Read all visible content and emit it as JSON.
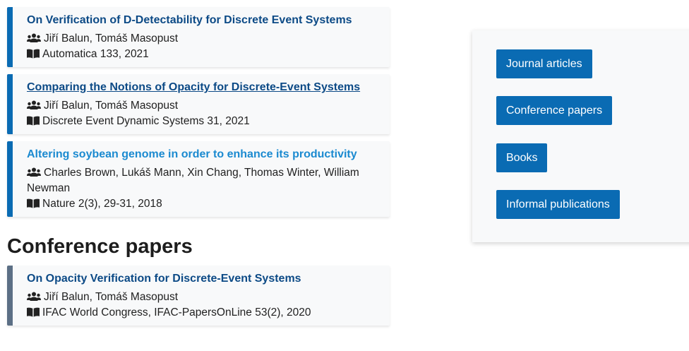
{
  "journal_articles": [
    {
      "title": "On Verification of D-Detectability for Discrete Event Systems",
      "authors": "Jiří Balun, Tomáš Masopust",
      "venue": "Automatica 133, 2021"
    },
    {
      "title": "Comparing the Notions of Opacity for Discrete-Event Systems",
      "authors": "Jiří Balun, Tomáš Masopust",
      "venue": "Discrete Event Dynamic Systems 31, 2021"
    },
    {
      "title": "Altering soybean genome in order to enhance its productivity",
      "authors": "Charles Brown, Lukáš Mann, Xin Chang, Thomas Winter, William Newman",
      "venue": "Nature 2(3), 29-31, 2018"
    }
  ],
  "conference_heading": "Conference papers",
  "conference_papers": [
    {
      "title": "On Opacity Verification for Discrete-Event Systems",
      "authors": "Jiří Balun, Tomáš Masopust",
      "venue": "IFAC World Congress, IFAC-PapersOnLine 53(2), 2020"
    }
  ],
  "nav": {
    "journal": "Journal articles",
    "conference": "Conference papers",
    "books": "Books",
    "informal": "Informal publications"
  },
  "colors": {
    "primary": "#0a6bb3",
    "title": "#0c4a86",
    "title_hover": "#1b8ad0",
    "conference_accent": "#5c6f85",
    "card_bg": "#f8f9fa"
  },
  "icons": {
    "authors": "users-icon",
    "venue": "book-icon"
  }
}
